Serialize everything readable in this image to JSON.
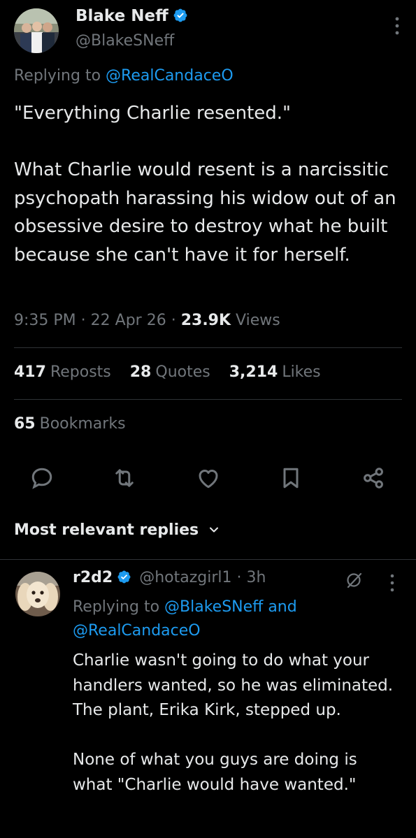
{
  "tweet": {
    "author_name": "Blake Neff",
    "author_handle": "@BlakeSNeff",
    "replying_prefix": "Replying to",
    "replying_to": "@RealCandaceO",
    "text": "\"Everything Charlie resented.\"\n\nWhat Charlie would resent is a narcissitic psychopath harassing his widow out of an obsessive desire to destroy what he built because she can't have it for herself.",
    "time": "9:35 PM",
    "date": "22 Apr 26",
    "views_count": "23.9K",
    "views_label": "Views",
    "reposts_count": "417",
    "reposts_label": "Reposts",
    "quotes_count": "28",
    "quotes_label": "Quotes",
    "likes_count": "3,214",
    "likes_label": "Likes",
    "bookmarks_count": "65",
    "bookmarks_label": "Bookmarks"
  },
  "actions": [
    "reply-icon",
    "repost-icon",
    "like-icon",
    "bookmark-icon",
    "share-icon"
  ],
  "sort": {
    "label": "Most relevant replies"
  },
  "reply": {
    "author_name": "r2d2",
    "author_handle": "@hotazgirl1",
    "age": "3h",
    "replying_prefix": "Replying to",
    "replying_to_1": "@BlakeSNeff",
    "replying_and": "and",
    "replying_to_2": "@RealCandaceO",
    "text": "Charlie wasn't going to do what your handlers wanted, so he was eliminated. The plant, Erika Kirk, stepped up.\n\nNone of what you guys are doing is what \"Charlie would have wanted.\""
  },
  "colors": {
    "background": "#000000",
    "text": "#e7e9ea",
    "muted": "#71767b",
    "accent": "#1d9bf0",
    "divider": "#2f3336"
  }
}
